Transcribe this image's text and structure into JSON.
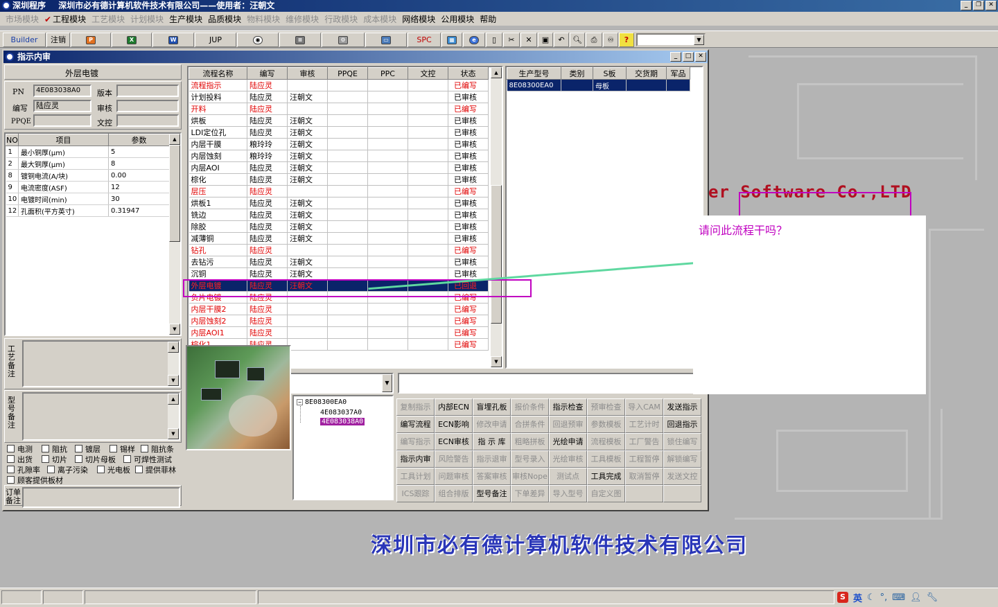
{
  "app": {
    "title": "深圳程序",
    "subtitle": "深圳市必有德计算机软件技术有限公司——使用者：汪朝文"
  },
  "menu": {
    "items": [
      {
        "label": "市场模块",
        "disabled": true
      },
      {
        "label": "工程模块",
        "disabled": false,
        "checked": true
      },
      {
        "label": "工艺模块",
        "disabled": true
      },
      {
        "label": "计划模块",
        "disabled": true
      },
      {
        "label": "生产模块",
        "disabled": false
      },
      {
        "label": "品质模块",
        "disabled": false
      },
      {
        "label": "物料模块",
        "disabled": true
      },
      {
        "label": "维修模块",
        "disabled": true
      },
      {
        "label": "行政模块",
        "disabled": true
      },
      {
        "label": "成本模块",
        "disabled": true
      },
      {
        "label": "网络模块",
        "disabled": false
      },
      {
        "label": "公用模块",
        "disabled": false
      },
      {
        "label": "帮助",
        "disabled": false
      }
    ]
  },
  "toolbar": {
    "builder": "Builder",
    "logout": "注销",
    "jup": "JUP",
    "spc": "SPC",
    "help_glyph": "?"
  },
  "background": {
    "slogan": "er Software Co.,LTD",
    "company": "深圳市必有德计算机软件技术有限公司"
  },
  "child": {
    "title": "指示内审",
    "section_title": "外层电镀",
    "fields": {
      "pn_label": "PN",
      "pn_value": "4E083038A0",
      "version_label": "版本",
      "author_label": "编写",
      "author_value": "陆应灵",
      "review_label": "审核",
      "ppqe_label": "PPQE",
      "wenkong_label": "文控"
    },
    "params": {
      "headers": [
        "NO",
        "项目",
        "参数"
      ],
      "rows": [
        [
          "1",
          "最小铜厚(μm)",
          "5"
        ],
        [
          "2",
          "最大铜厚(μm)",
          "8"
        ],
        [
          "8",
          "镀铜电流(A/块)",
          "0.00"
        ],
        [
          "9",
          "电流密度(ASF)",
          "12"
        ],
        [
          "10",
          "电镀时间(min)",
          "30"
        ],
        [
          "12",
          "孔面积(平方英寸)",
          "0.31947"
        ]
      ]
    },
    "notes": {
      "craft_label": "工艺备注",
      "model_label": "型号备注",
      "order_label": "订单备注"
    },
    "checkboxes": [
      [
        "电测",
        "阻抗",
        "镀层",
        "锡样",
        "阻抗条"
      ],
      [
        "出货",
        "切片",
        "切片母板",
        "可焊性测试"
      ],
      [
        "孔隙率",
        "离子污染",
        "光电板",
        "提供菲林"
      ],
      [
        "顾客提供板材"
      ]
    ],
    "flow": {
      "headers": [
        "流程名称",
        "编写",
        "审核",
        "PPQE",
        "PPC",
        "文控",
        "状态"
      ],
      "rows": [
        {
          "cells": [
            "流程指示",
            "陆应灵",
            "",
            "",
            "",
            "",
            "已编写"
          ],
          "style": "red"
        },
        {
          "cells": [
            "计划投料",
            "陆应灵",
            "汪朝文",
            "",
            "",
            "",
            "已审核"
          ],
          "style": ""
        },
        {
          "cells": [
            "开料",
            "陆应灵",
            "",
            "",
            "",
            "",
            "已编写"
          ],
          "style": "red"
        },
        {
          "cells": [
            "烘板",
            "陆应灵",
            "汪朝文",
            "",
            "",
            "",
            "已审核"
          ],
          "style": ""
        },
        {
          "cells": [
            "LDI定位孔",
            "陆应灵",
            "汪朝文",
            "",
            "",
            "",
            "已审核"
          ],
          "style": ""
        },
        {
          "cells": [
            "内层干膜",
            "粮玲玲",
            "汪朝文",
            "",
            "",
            "",
            "已审核"
          ],
          "style": ""
        },
        {
          "cells": [
            "内层蚀刻",
            "粮玲玲",
            "汪朝文",
            "",
            "",
            "",
            "已审核"
          ],
          "style": ""
        },
        {
          "cells": [
            "内层AOI",
            "陆应灵",
            "汪朝文",
            "",
            "",
            "",
            "已审核"
          ],
          "style": ""
        },
        {
          "cells": [
            "棕化",
            "陆应灵",
            "汪朝文",
            "",
            "",
            "",
            "已审核"
          ],
          "style": ""
        },
        {
          "cells": [
            "层压",
            "陆应灵",
            "",
            "",
            "",
            "",
            "已编写"
          ],
          "style": "red"
        },
        {
          "cells": [
            "烘板1",
            "陆应灵",
            "汪朝文",
            "",
            "",
            "",
            "已审核"
          ],
          "style": ""
        },
        {
          "cells": [
            "铣边",
            "陆应灵",
            "汪朝文",
            "",
            "",
            "",
            "已审核"
          ],
          "style": ""
        },
        {
          "cells": [
            "除胶",
            "陆应灵",
            "汪朝文",
            "",
            "",
            "",
            "已审核"
          ],
          "style": ""
        },
        {
          "cells": [
            "减薄铜",
            "陆应灵",
            "汪朝文",
            "",
            "",
            "",
            "已审核"
          ],
          "style": ""
        },
        {
          "cells": [
            "钻孔",
            "陆应灵",
            "",
            "",
            "",
            "",
            "已编写"
          ],
          "style": "red"
        },
        {
          "cells": [
            "去钻污",
            "陆应灵",
            "汪朝文",
            "",
            "",
            "",
            "已审核"
          ],
          "style": ""
        },
        {
          "cells": [
            "沉铜",
            "陆应灵",
            "汪朝文",
            "",
            "",
            "",
            "已审核"
          ],
          "style": ""
        },
        {
          "cells": [
            "外层电镀",
            "陆应灵",
            "汪朝文",
            "",
            "",
            "",
            "已回退"
          ],
          "style": "sel"
        },
        {
          "cells": [
            "负片电镀",
            "陆应灵",
            "",
            "",
            "",
            "",
            "已编写"
          ],
          "style": "red"
        },
        {
          "cells": [
            "内层干膜2",
            "陆应灵",
            "",
            "",
            "",
            "",
            "已编写"
          ],
          "style": "red"
        },
        {
          "cells": [
            "内层蚀刻2",
            "陆应灵",
            "",
            "",
            "",
            "",
            "已编写"
          ],
          "style": "red"
        },
        {
          "cells": [
            "内层AOI1",
            "陆应灵",
            "",
            "",
            "",
            "",
            "已编写"
          ],
          "style": "red"
        },
        {
          "cells": [
            "棕化1",
            "陆应灵",
            "",
            "",
            "",
            "",
            "已编写"
          ],
          "style": "red"
        }
      ]
    },
    "production": {
      "headers": [
        "生产型号",
        "类别",
        "S板",
        "交货期",
        "军品"
      ],
      "rows": [
        [
          "8E08300EA0",
          "",
          "母板",
          "",
          ""
        ]
      ]
    },
    "tree": {
      "root": "8E08300EA0",
      "children": [
        "4E083037A0",
        "4E083038A0"
      ]
    },
    "buttons": [
      {
        "label": "复制指示",
        "disabled": true
      },
      {
        "label": "内部ECN",
        "disabled": false
      },
      {
        "label": "盲埋孔板",
        "disabled": false
      },
      {
        "label": "报价条件",
        "disabled": true
      },
      {
        "label": "指示检查",
        "disabled": false
      },
      {
        "label": "预审检查",
        "disabled": true
      },
      {
        "label": "导入CAM",
        "disabled": true
      },
      {
        "label": "发送指示",
        "disabled": false
      },
      {
        "label": "编写流程",
        "disabled": false
      },
      {
        "label": "ECN影响",
        "disabled": false
      },
      {
        "label": "修改申请",
        "disabled": true
      },
      {
        "label": "合拼条件",
        "disabled": true
      },
      {
        "label": "回退预审",
        "disabled": true
      },
      {
        "label": "参数模板",
        "disabled": true
      },
      {
        "label": "工艺计时",
        "disabled": true
      },
      {
        "label": "回退指示",
        "disabled": false
      },
      {
        "label": "编写指示",
        "disabled": true
      },
      {
        "label": "ECN审核",
        "disabled": false
      },
      {
        "label": "指 示 库",
        "disabled": false
      },
      {
        "label": "粗略拼板",
        "disabled": true
      },
      {
        "label": "光绘申请",
        "disabled": false
      },
      {
        "label": "流程模板",
        "disabled": true
      },
      {
        "label": "工厂警告",
        "disabled": true
      },
      {
        "label": "锁住编写",
        "disabled": true
      },
      {
        "label": "指示内审",
        "disabled": false
      },
      {
        "label": "风险警告",
        "disabled": true
      },
      {
        "label": "指示退审",
        "disabled": true
      },
      {
        "label": "型号录入",
        "disabled": true
      },
      {
        "label": "光绘审核",
        "disabled": true
      },
      {
        "label": "工具模板",
        "disabled": true
      },
      {
        "label": "工程暂停",
        "disabled": true
      },
      {
        "label": "解锁编写",
        "disabled": true
      },
      {
        "label": "工具计划",
        "disabled": true
      },
      {
        "label": "问题审核",
        "disabled": true
      },
      {
        "label": "答案审核",
        "disabled": true
      },
      {
        "label": "审核Nope",
        "disabled": true
      },
      {
        "label": "测试点",
        "disabled": true
      },
      {
        "label": "工具完成",
        "disabled": false
      },
      {
        "label": "取消暂停",
        "disabled": true
      },
      {
        "label": "发送文控",
        "disabled": true
      },
      {
        "label": "ICS跟踪",
        "disabled": true
      },
      {
        "label": "组合排版",
        "disabled": true
      },
      {
        "label": "型号备注",
        "disabled": false
      },
      {
        "label": "下单差异",
        "disabled": true
      },
      {
        "label": "导入型号",
        "disabled": true
      },
      {
        "label": "自定义图",
        "disabled": true
      },
      {
        "label": "",
        "disabled": true
      },
      {
        "label": "",
        "disabled": true
      }
    ]
  },
  "annotation": {
    "question": "请问此流程干吗？"
  },
  "ime": {
    "logo": "S",
    "lang": "英"
  }
}
